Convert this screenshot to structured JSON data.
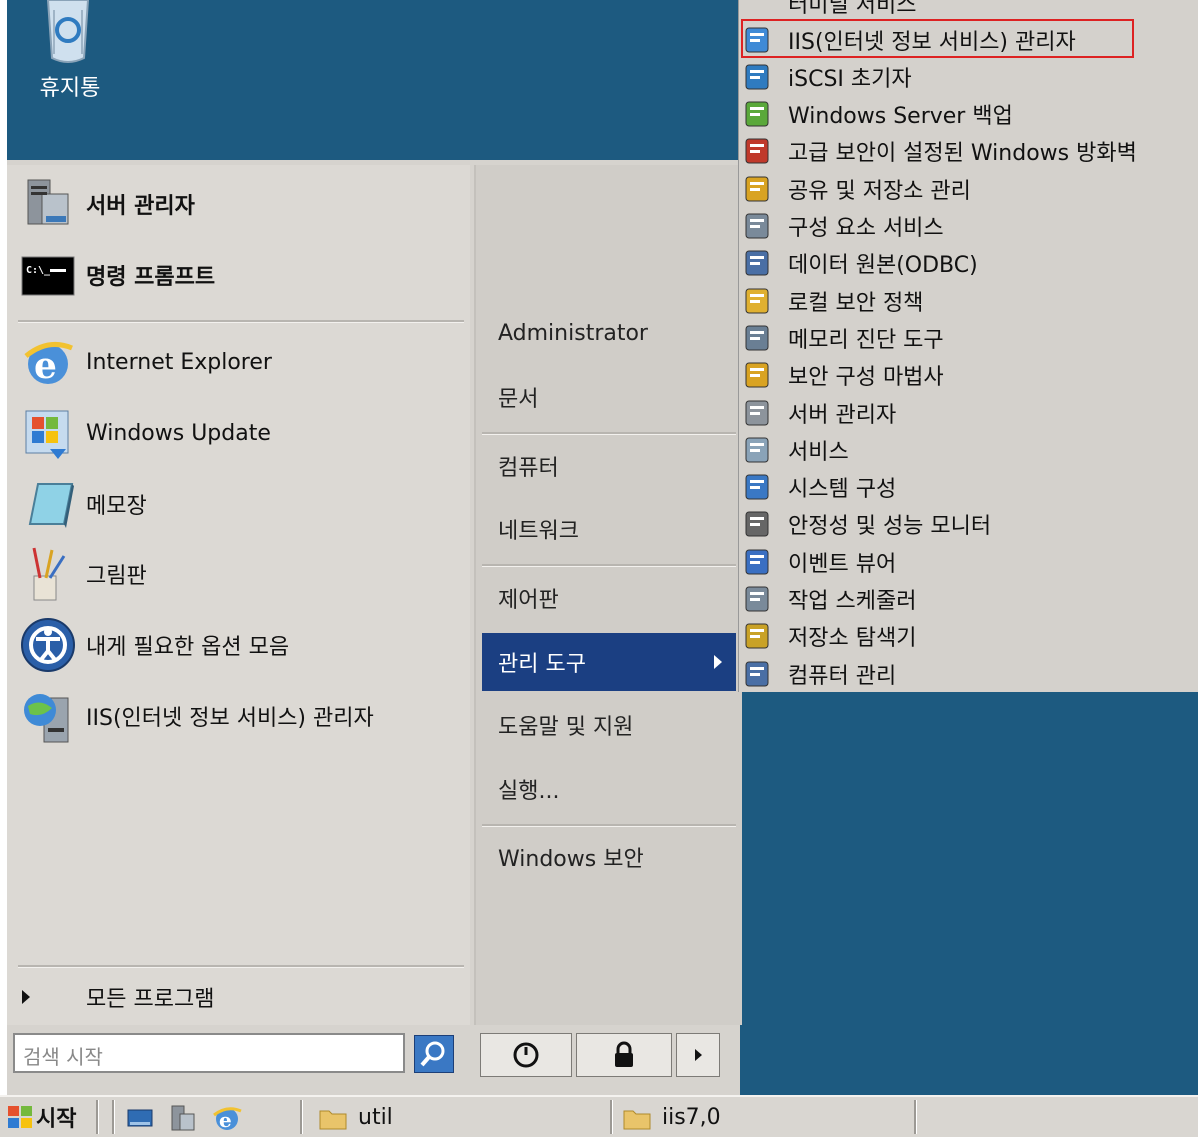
{
  "desktop": {
    "recycle_bin_label": "휴지통"
  },
  "start_menu": {
    "pinned": [
      {
        "label": "서버 관리자",
        "icon": "server-manager-icon"
      },
      {
        "label": "명령 프롬프트",
        "icon": "command-prompt-icon"
      }
    ],
    "recent": [
      {
        "label": "Internet Explorer",
        "icon": "internet-explorer-icon"
      },
      {
        "label": "Windows Update",
        "icon": "windows-update-icon"
      },
      {
        "label": "메모장",
        "icon": "notepad-icon"
      },
      {
        "label": "그림판",
        "icon": "paint-icon"
      },
      {
        "label": "내게 필요한 옵션 모음",
        "icon": "ease-of-access-icon"
      },
      {
        "label": "IIS(인터넷 정보 서비스) 관리자",
        "icon": "iis-manager-icon"
      }
    ],
    "all_programs": "모든 프로그램",
    "search_placeholder": "검색 시작",
    "right": {
      "administrator": "Administrator",
      "documents": "문서",
      "computer": "컴퓨터",
      "network": "네트워크",
      "control_panel": "제어판",
      "admin_tools": "관리 도구",
      "help": "도움말 및 지원",
      "run": "실행...",
      "windows_security": "Windows 보안"
    }
  },
  "admin_tools_submenu": {
    "partial_top": "터미널 서비스",
    "items": [
      {
        "label": "IIS(인터넷 정보 서비스) 관리자",
        "icon": "iis-icon",
        "highlighted": true
      },
      {
        "label": "iSCSI 초기자",
        "icon": "iscsi-icon"
      },
      {
        "label": "Windows Server 백업",
        "icon": "backup-icon"
      },
      {
        "label": "고급 보안이 설정된 Windows 방화벽",
        "icon": "firewall-icon"
      },
      {
        "label": "공유 및 저장소 관리",
        "icon": "share-storage-icon"
      },
      {
        "label": "구성 요소 서비스",
        "icon": "component-services-icon"
      },
      {
        "label": "데이터 원본(ODBC)",
        "icon": "odbc-icon"
      },
      {
        "label": "로컬 보안 정책",
        "icon": "local-security-policy-icon"
      },
      {
        "label": "메모리 진단 도구",
        "icon": "memory-diagnostic-icon"
      },
      {
        "label": "보안 구성 마법사",
        "icon": "security-wizard-icon"
      },
      {
        "label": "서버 관리자",
        "icon": "server-manager-icon"
      },
      {
        "label": "서비스",
        "icon": "services-icon"
      },
      {
        "label": "시스템 구성",
        "icon": "system-config-icon"
      },
      {
        "label": "안정성 및 성능 모니터",
        "icon": "performance-monitor-icon"
      },
      {
        "label": "이벤트 뷰어",
        "icon": "event-viewer-icon"
      },
      {
        "label": "작업 스케줄러",
        "icon": "task-scheduler-icon"
      },
      {
        "label": "저장소 탐색기",
        "icon": "storage-explorer-icon"
      },
      {
        "label": "컴퓨터 관리",
        "icon": "computer-management-icon"
      }
    ]
  },
  "taskbar": {
    "start_label": "시작",
    "tasks": [
      {
        "label": "util"
      },
      {
        "label": "iis7,0"
      }
    ]
  },
  "colors": {
    "desktop": "#1d5a80",
    "selection": "#1b3f82",
    "highlight_border": "#dd2222"
  }
}
